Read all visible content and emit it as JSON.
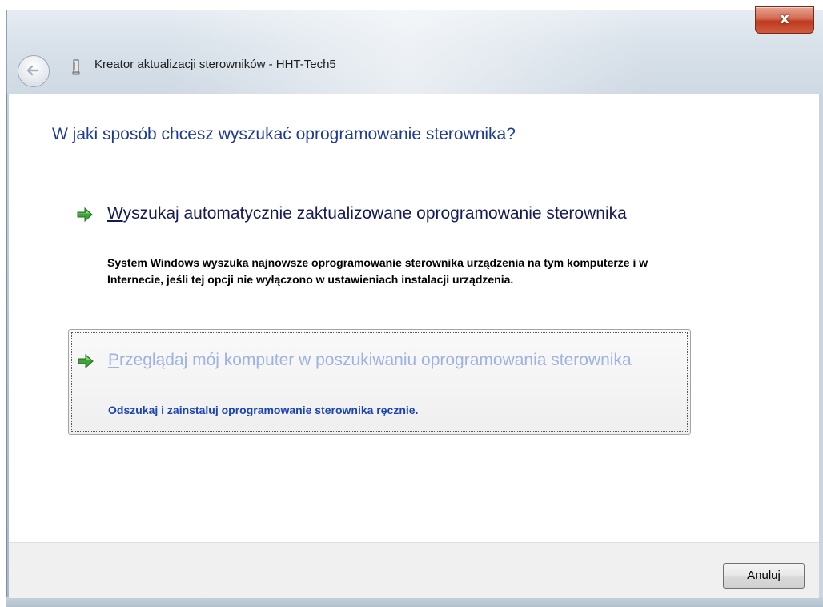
{
  "window": {
    "title": "Kreator aktualizacji sterowników - HHT-Tech5",
    "close_label": "x",
    "icons": {
      "back": "back-arrow-icon",
      "device": "device-icon",
      "close": "close-icon"
    }
  },
  "main": {
    "heading": "W jaki sposób chcesz wyszukać oprogramowanie sterownika?",
    "options": [
      {
        "accesskey": "W",
        "title_rest": "yszukaj automatycznie zaktualizowane oprogramowanie sterownika",
        "description": "System Windows wyszuka najnowsze oprogramowanie sterownika urządzenia na tym komputerze i w Internecie, jeśli tej opcji nie wyłączono w ustawieniach instalacji urządzenia.",
        "icon": "green-arrow-icon"
      },
      {
        "accesskey": "P",
        "title_rest": "rzeglądaj mój komputer w poszukiwaniu oprogramowania sterownika",
        "description": "Odszukaj i zainstaluj oprogramowanie sterownika ręcznie.",
        "icon": "green-arrow-icon"
      }
    ]
  },
  "footer": {
    "cancel_label": "Anuluj"
  },
  "colors": {
    "heading": "#1f3c94",
    "hover_title": "#9eb3e2",
    "hover_desc": "#1a44b5",
    "close": "#c0391e"
  }
}
